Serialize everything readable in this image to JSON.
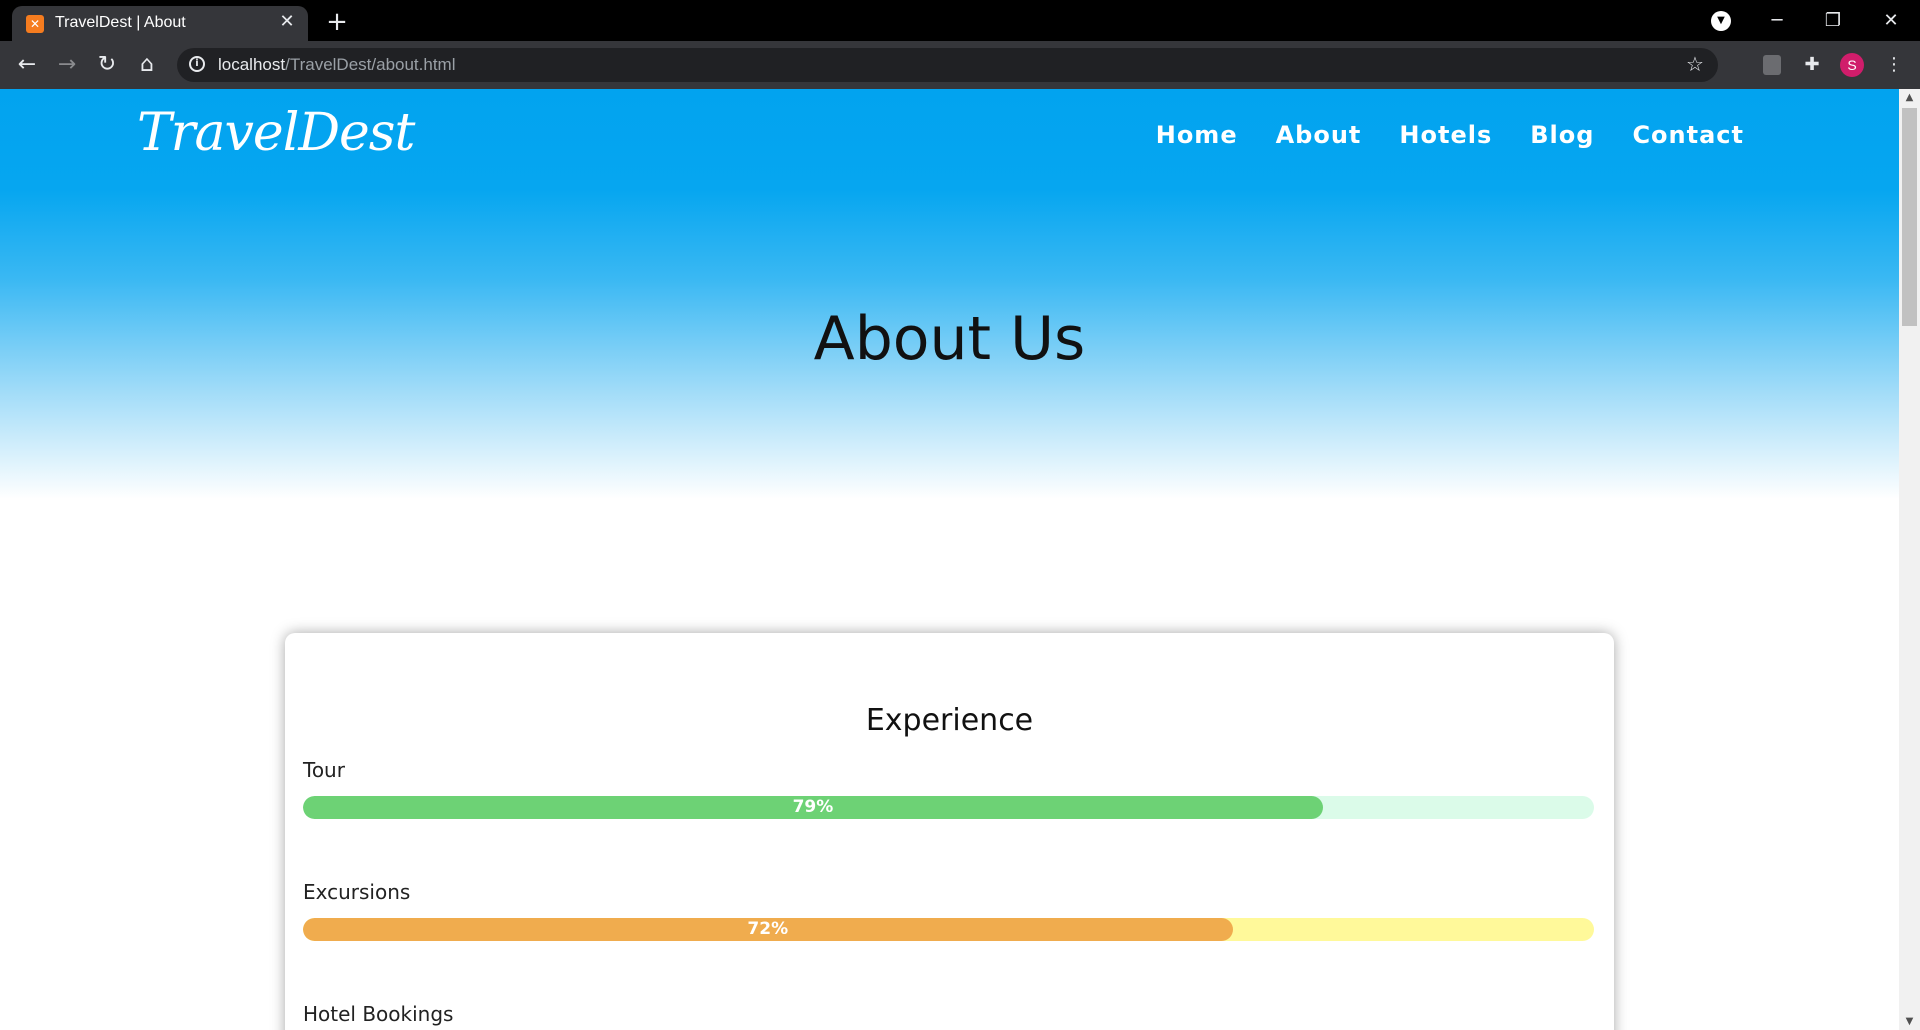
{
  "browser": {
    "tab_title": "TravelDest | About",
    "tab_close_glyph": "✕",
    "new_tab_glyph": "+",
    "url_host": "localhost",
    "url_path": "/TravelDest/about.html",
    "avatar_letter": "S",
    "icons": [
      "back-icon",
      "forward-icon",
      "reload-icon",
      "home-icon",
      "info-icon",
      "star-icon",
      "extensions-icon",
      "menu-icon",
      "media-control-icon"
    ]
  },
  "site": {
    "logo": "TravelDest",
    "nav": [
      "Home",
      "About",
      "Hotels",
      "Blog",
      "Contact"
    ],
    "page_title": "About Us"
  },
  "experience": {
    "title": "Experience",
    "skills": [
      {
        "label": "Tour",
        "percent": 79,
        "percent_label": "79%",
        "fill_color": "#6dd275",
        "track_color": "#dbfbe9"
      },
      {
        "label": "Excursions",
        "percent": 72,
        "percent_label": "72%",
        "fill_color": "#f0ac4e",
        "track_color": "#fff99a"
      },
      {
        "label": "Hotel Bookings"
      }
    ]
  },
  "colors": {
    "hero_top": "#02a3ef",
    "chrome_dark": "#35363a"
  }
}
